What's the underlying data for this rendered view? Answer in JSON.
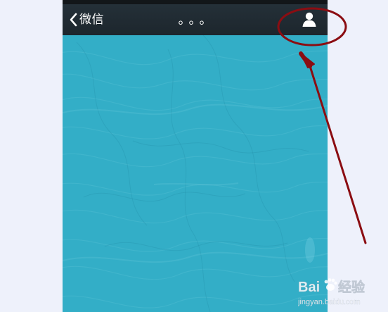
{
  "navbar": {
    "back_label": "微信",
    "title": "。。。",
    "back_icon": "chevron-left-icon",
    "profile_icon": "person-icon"
  },
  "chat": {
    "wallpaper": "blue-swirl-texture"
  },
  "annotation": {
    "highlight_color": "#8b0d12",
    "target": "profile-button"
  },
  "watermark": {
    "brand_text": "Baidu经验",
    "url_text": "jingyan.baidu.com"
  },
  "colors": {
    "navbar": "#1f2930",
    "chat_background": "#33aec7",
    "page_background": "#eef1fb",
    "annotation": "#8b0d12"
  }
}
